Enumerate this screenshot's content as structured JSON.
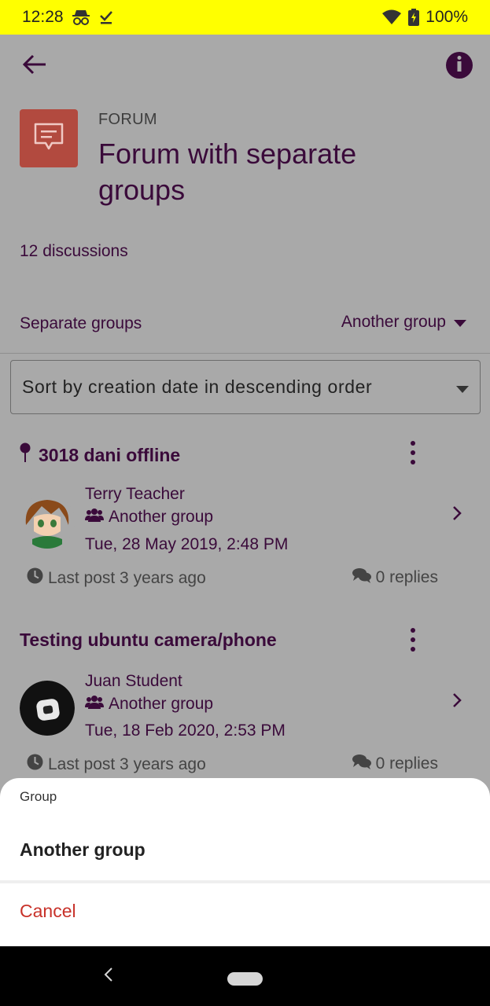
{
  "status_bar": {
    "time": "12:28",
    "battery": "100%"
  },
  "header": {
    "back_icon": "arrow-left-icon",
    "info_icon": "info-icon"
  },
  "forum": {
    "type_label": "FORUM",
    "title": "Forum with separate groups",
    "icon": "forum-chat-icon",
    "icon_color": "#b24a3f",
    "discussions": "12 discussions"
  },
  "groups": {
    "label": "Separate groups",
    "selected": "Another group"
  },
  "sort": {
    "selected": "Sort by creation date in descending order"
  },
  "discussions": [
    {
      "title": "3018 dani offline",
      "pinned": true,
      "author": "Terry Teacher",
      "group": "Another group",
      "date": "Tue, 28 May 2019, 2:48 PM",
      "last_post": "Last post 3 years ago",
      "replies": "0 replies"
    },
    {
      "title": "Testing ubuntu camera/phone",
      "pinned": false,
      "author": "Juan Student",
      "group": "Another group",
      "date": "Tue, 18 Feb 2020, 2:53 PM",
      "last_post": "Last post 3 years ago",
      "replies": "0 replies"
    }
  ],
  "sheet": {
    "title": "Group",
    "option": "Another group",
    "cancel": "Cancel",
    "cancel_color": "#c8322a"
  }
}
